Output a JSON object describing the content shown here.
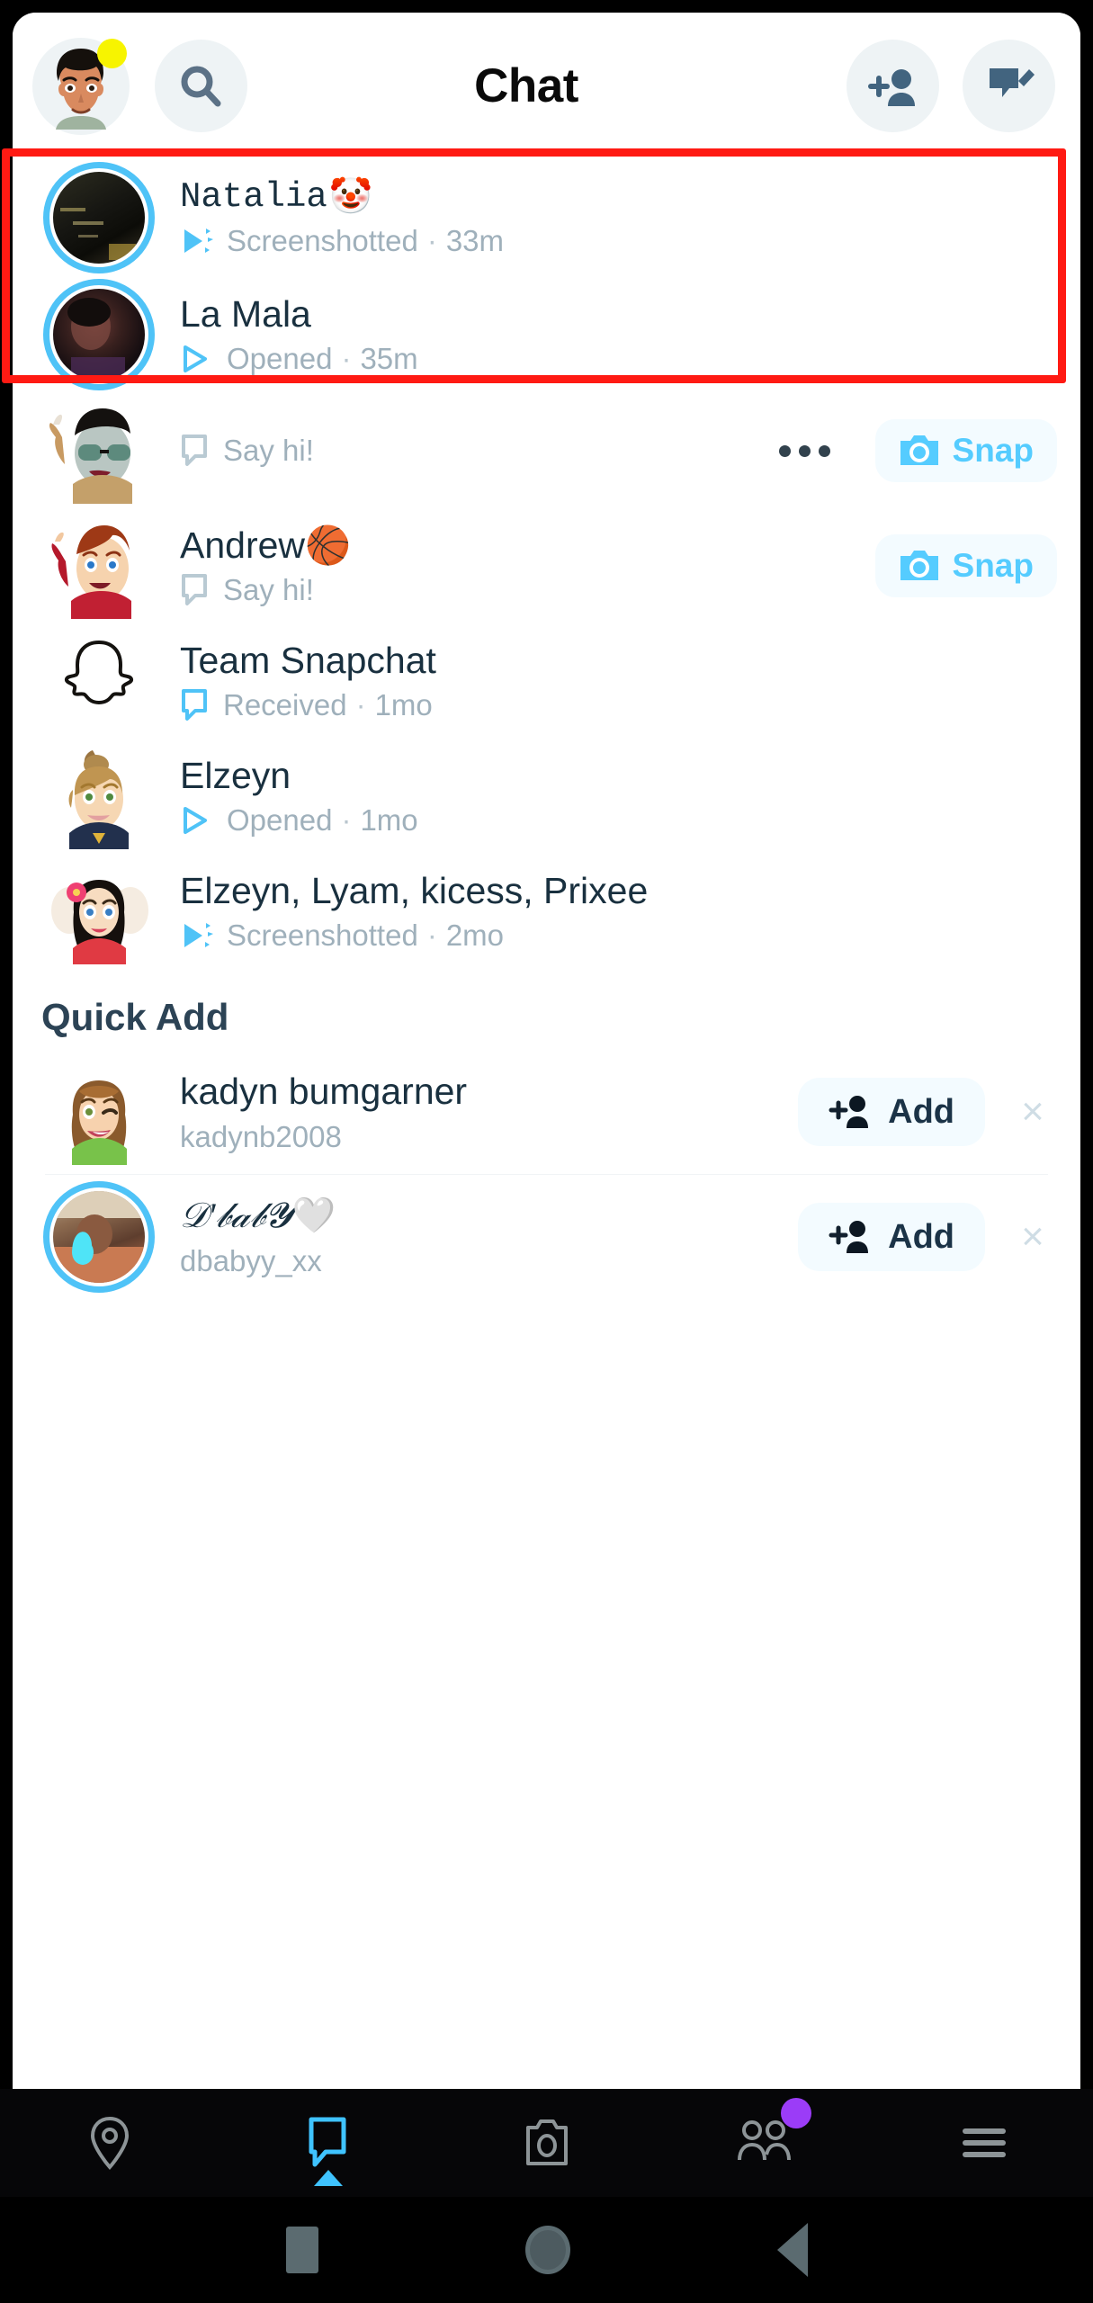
{
  "app": {
    "title": "Chat"
  },
  "header": {
    "avatar_name": "profile-bitmoji",
    "status_badge_color": "#f7f400",
    "search_icon": "search-icon",
    "add_friend_icon": "add-friend-icon",
    "new_chat_icon": "new-chat-icon"
  },
  "colors": {
    "snap_blue": "#55ccff",
    "ring_blue": "#4fc3f7",
    "name_dark": "#19303f",
    "subtext_gray": "#9fb0bb",
    "highlight_red": "#ff1a13",
    "badge_purple": "#9b3cf7",
    "status_yellow": "#f7f400"
  },
  "highlight": {
    "present": true,
    "label": "red-highlight-box"
  },
  "chats": [
    {
      "name": "Natalia",
      "emoji": "🤡",
      "status": "Screenshotted",
      "time": "33m",
      "separator": "·",
      "status_icon": "screenshot-arrow-icon",
      "avatar_type": "photo",
      "has_ring": true,
      "highlighted": true
    },
    {
      "name": "La Mala",
      "emoji": "",
      "status": "Opened",
      "time": "35m",
      "separator": "·",
      "status_icon": "opened-arrow-icon",
      "avatar_type": "photo",
      "has_ring": true,
      "highlighted": true
    },
    {
      "name": "",
      "emoji": "",
      "status": "Say hi!",
      "time": "",
      "separator": "",
      "status_icon": "chat-bubble-icon",
      "avatar_type": "bitmoji-sunglasses",
      "has_ring": false,
      "highlighted": false,
      "action": "Snap",
      "has_dots": true
    },
    {
      "name": "Andrew",
      "emoji": "🏀",
      "status": "Say hi!",
      "time": "",
      "separator": "",
      "status_icon": "chat-bubble-icon",
      "avatar_type": "bitmoji-redhair",
      "has_ring": false,
      "highlighted": false,
      "action": "Snap",
      "has_dots": false
    },
    {
      "name": "Team Snapchat",
      "emoji": "",
      "status": "Received",
      "time": "1mo",
      "separator": "·",
      "status_icon": "chat-bubble-icon-blue",
      "avatar_type": "ghost",
      "has_ring": false,
      "highlighted": false
    },
    {
      "name": "Elzeyn",
      "emoji": "",
      "status": "Opened",
      "time": "1mo",
      "separator": "·",
      "status_icon": "opened-arrow-icon",
      "avatar_type": "bitmoji-bun",
      "has_ring": false,
      "highlighted": false
    },
    {
      "name": "Elzeyn, Lyam, kicess, Prixee",
      "emoji": "",
      "status": "Screenshotted",
      "time": "2mo",
      "separator": "·",
      "status_icon": "screenshot-arrow-icon",
      "avatar_type": "bitmoji-group",
      "has_ring": false,
      "highlighted": false
    }
  ],
  "quick_add": {
    "title": "Quick Add",
    "items": [
      {
        "name": "kadyn bumgarner",
        "emoji": "",
        "username": "kadynb2008",
        "add_label": "Add",
        "dismiss_label": "×",
        "avatar_type": "bitmoji-wink",
        "has_ring": false
      },
      {
        "name": "𝒟'𝒷𝒶𝒷𝓨",
        "emoji": "🤍",
        "username": "dbabyy_xx",
        "add_label": "Add",
        "dismiss_label": "×",
        "avatar_type": "photo-blue",
        "has_ring": true
      }
    ]
  },
  "bottom_nav": {
    "items": [
      {
        "icon": "map-pin-icon",
        "active": false,
        "badge": false
      },
      {
        "icon": "chat-bubble-icon",
        "active": true,
        "badge": false
      },
      {
        "icon": "camera-icon",
        "active": false,
        "badge": false
      },
      {
        "icon": "friends-icon",
        "active": false,
        "badge": true
      },
      {
        "icon": "hamburger-menu-icon",
        "active": false,
        "badge": false
      }
    ]
  },
  "system_nav": {
    "items": [
      {
        "icon": "recents-square-icon"
      },
      {
        "icon": "home-circle-icon"
      },
      {
        "icon": "back-triangle-icon"
      }
    ]
  }
}
